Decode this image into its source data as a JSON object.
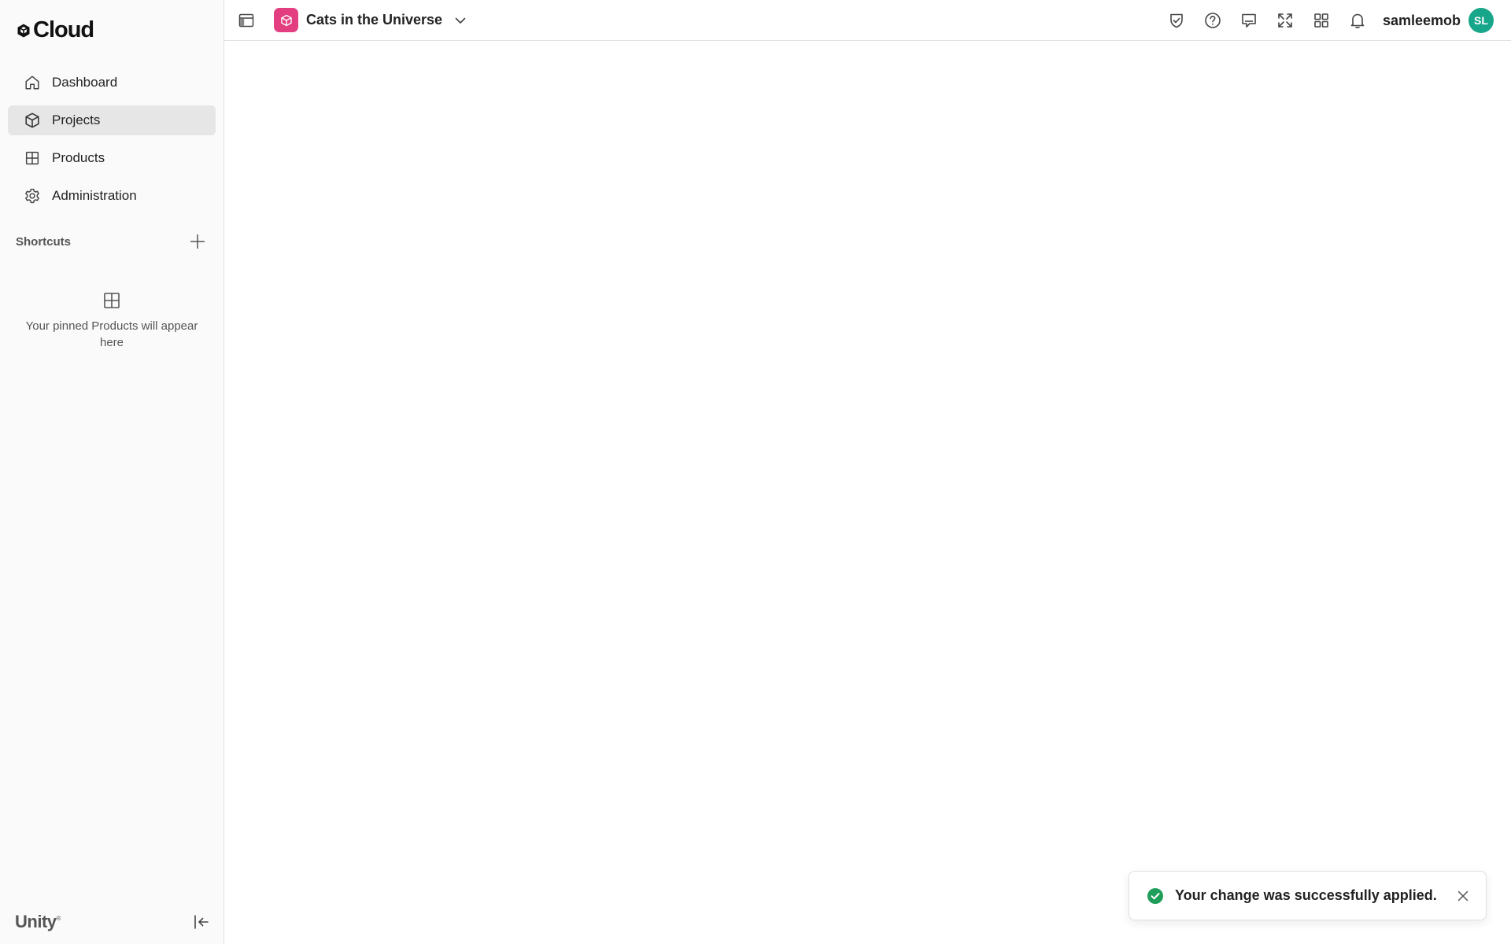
{
  "app": {
    "logo_text": "Cloud",
    "brand_footer": "Unity",
    "brand_mark": "®"
  },
  "sidebar": {
    "items": [
      {
        "label": "Dashboard",
        "icon": "home-icon",
        "active": false
      },
      {
        "label": "Projects",
        "icon": "cube-icon",
        "active": true
      },
      {
        "label": "Products",
        "icon": "grid-icon",
        "active": false
      },
      {
        "label": "Administration",
        "icon": "gear-icon",
        "active": false
      }
    ],
    "shortcuts_label": "Shortcuts",
    "empty_pins_text": "Your pinned Products will appear here"
  },
  "topbar": {
    "project_name": "Cats in the Universe",
    "project_color": "#e33e7f",
    "username": "samleemob",
    "avatar_initials": "SL",
    "avatar_color": "#18a68b",
    "icons": [
      "shield-check-icon",
      "help-icon",
      "feedback-icon",
      "fullscreen-icon",
      "apps-icon",
      "bell-icon"
    ]
  },
  "toast": {
    "message": "Your change was successfully applied.",
    "status_color": "#1e9e5a"
  }
}
